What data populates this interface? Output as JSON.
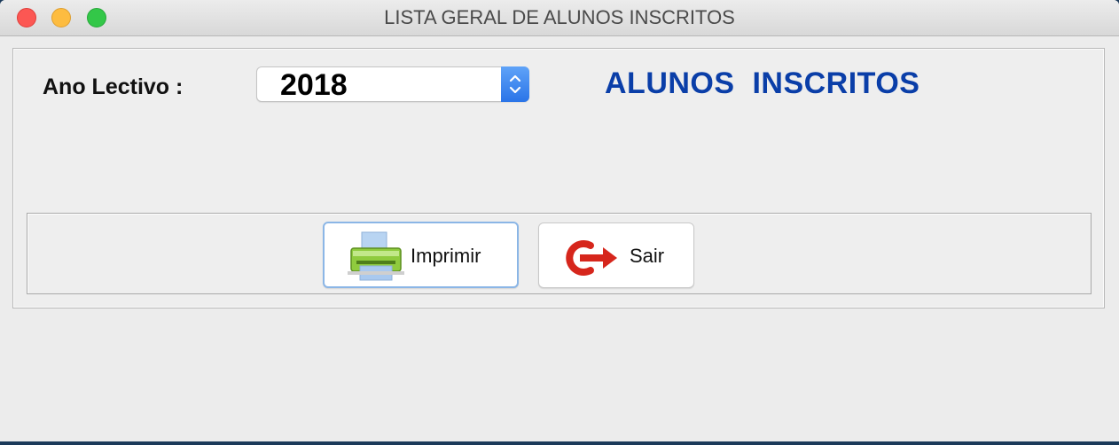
{
  "window": {
    "title": "LISTA GERAL DE ALUNOS INSCRITOS"
  },
  "form": {
    "ano_lectivo_label": "Ano Lectivo :",
    "ano_lectivo_value": "2018",
    "heading": "ALUNOS  INSCRITOS"
  },
  "buttons": {
    "imprimir": {
      "label": "Imprimir",
      "icon": "printer-icon"
    },
    "sair": {
      "label": "Sair",
      "icon": "exit-icon"
    }
  },
  "colors": {
    "heading": "#0a3ea8",
    "combo_accent": "#2a74e8",
    "close": "#fc5753",
    "minimize": "#fdbc40",
    "maximize": "#33c748"
  }
}
